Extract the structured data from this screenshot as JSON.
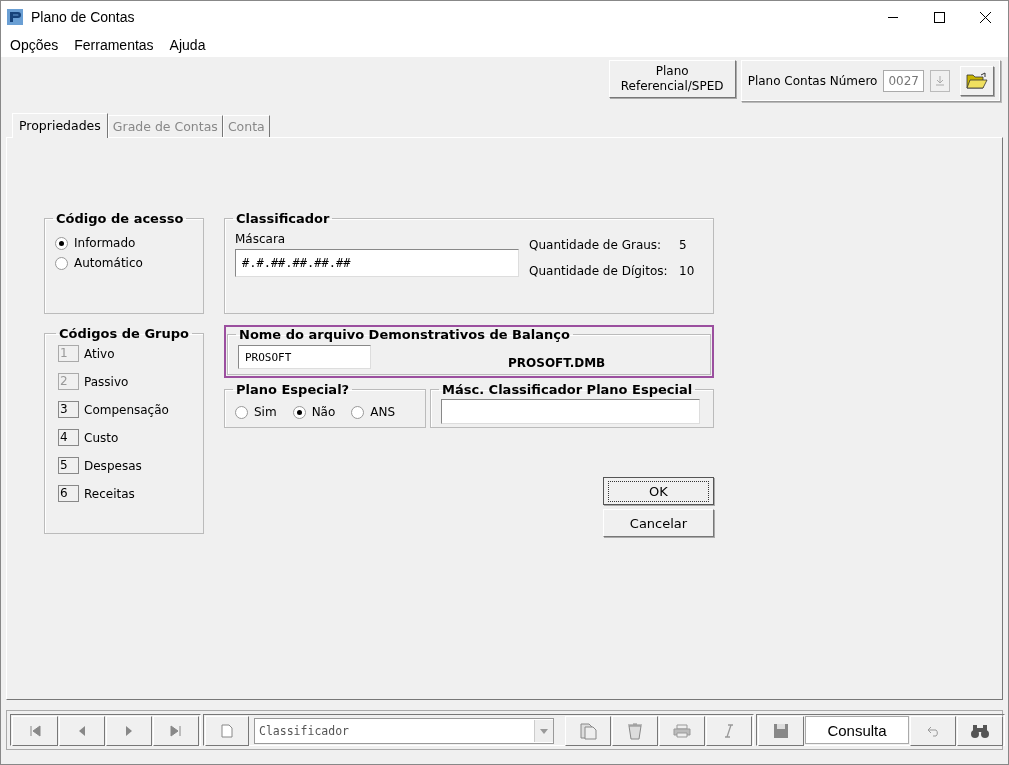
{
  "window": {
    "title": "Plano de Contas"
  },
  "menu": [
    "Opções",
    "Ferramentas",
    "Ajuda"
  ],
  "top": {
    "sped_button": "Plano Referencial/SPED",
    "plan_label": "Plano Contas Número",
    "plan_number": "0027"
  },
  "tabs": [
    {
      "label": "Propriedades",
      "selected": true,
      "disabled": false
    },
    {
      "label": "Grade de Contas",
      "selected": false,
      "disabled": true
    },
    {
      "label": "Conta",
      "selected": false,
      "disabled": true
    }
  ],
  "access_code": {
    "title": "Código de acesso",
    "options": [
      {
        "label": "Informado",
        "selected": true
      },
      {
        "label": "Automático",
        "selected": false
      }
    ]
  },
  "group_codes": {
    "title": "Códigos de Grupo",
    "items": [
      {
        "code": "1",
        "label": "Ativo",
        "disabled": true
      },
      {
        "code": "2",
        "label": "Passivo",
        "disabled": true
      },
      {
        "code": "3",
        "label": "Compensação",
        "disabled": false
      },
      {
        "code": "4",
        "label": "Custo",
        "disabled": false
      },
      {
        "code": "5",
        "label": "Despesas",
        "disabled": false
      },
      {
        "code": "6",
        "label": "Receitas",
        "disabled": false
      }
    ]
  },
  "classifier": {
    "title": "Classificador",
    "mask_label": "Máscara",
    "mask_value": "#.#.##.##.##.##",
    "stats": [
      {
        "label": "Quantidade de Graus:",
        "value": "5"
      },
      {
        "label": "Quantidade de Dígitos:",
        "value": "10"
      }
    ]
  },
  "balance_file": {
    "title": "Nome do arquivo Demonstrativos de Balanço",
    "value": "PROSOFT",
    "file_name": "PROSOFT.DMB",
    "highlighted": true
  },
  "special_plan": {
    "title": "Plano Especial?",
    "options": [
      {
        "label": "Sim",
        "selected": false
      },
      {
        "label": "Não",
        "selected": true
      },
      {
        "label": "ANS",
        "selected": false
      }
    ]
  },
  "special_mask": {
    "title": "Másc. Classificador Plano Especial"
  },
  "buttons": [
    {
      "label": "OK",
      "focused": true
    },
    {
      "label": "Cancelar",
      "focused": false
    }
  ],
  "navigator": {
    "combo_value": "Classificador",
    "mode": "Consulta"
  }
}
